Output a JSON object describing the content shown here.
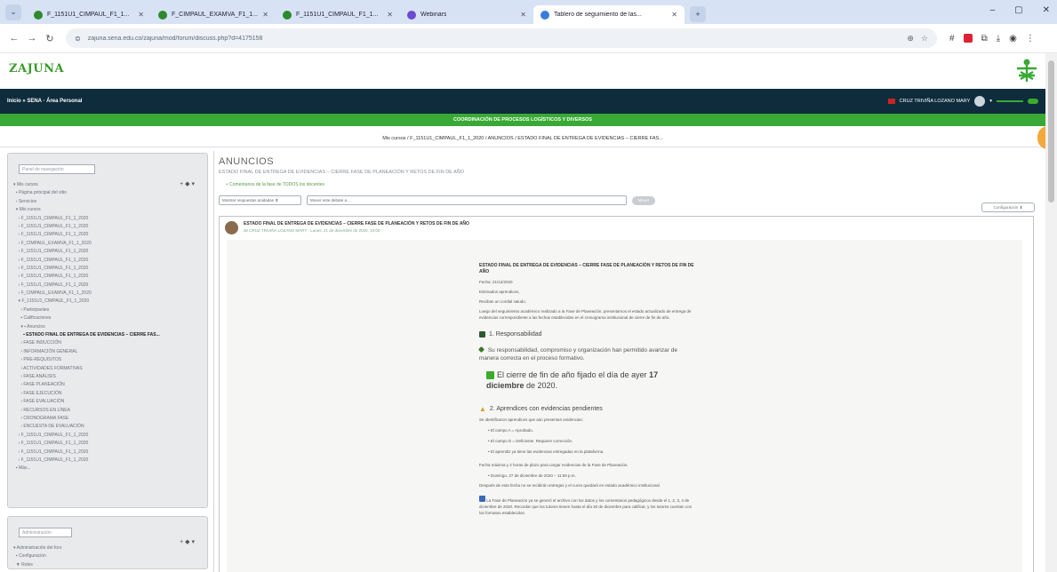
{
  "browser": {
    "tabs": [
      {
        "title": "F_1151U1_CIMPAUL_F1_1...",
        "color": "#2d8a2d",
        "active": false
      },
      {
        "title": "F_CIMPAUL_EXAMVA_F1_1...",
        "color": "#2d8a2d",
        "active": false
      },
      {
        "title": "F_1151U1_CIMPAUL_F1_1...",
        "color": "#2d8a2d",
        "active": false
      },
      {
        "title": "Webinars",
        "color": "#6b4bd1",
        "active": false
      },
      {
        "title": "Tablero de seguimiento de las...",
        "color": "#3a7be0",
        "active": true
      }
    ],
    "url": "zajuna.sena.edu.co/zajuna/mod/forum/discuss.php?d=4175158",
    "win_controls": [
      "–",
      "▢",
      "✕"
    ]
  },
  "site": {
    "logo": "ZAJUNA",
    "breadcrumb_left": "Inicio » SENA · Área Personal",
    "user_name": "CRUZ TRIVIÑA LOZANO MARY",
    "green_banner": "COORDINACIÓN DE PROCESOS LOGÍSTICOS Y DIVERSOS",
    "breadcrumb": "Mis cursos  /  F_1151U1_CIMPAUL_F1_1_2020  /  ANUNCIOS  /  ESTADO FINAL DE ENTREGA DE EVIDENCIAS – CIERRE FAS..."
  },
  "sidebar": {
    "block1_title": "Panel de navegación",
    "search_placeholder": "Buscar",
    "items": [
      {
        "label": "▾ Mis cursos",
        "sel": false
      },
      {
        "label": "  ▪ Página principal del sitio",
        "sel": false
      },
      {
        "label": "  › Servicios",
        "sel": false
      },
      {
        "label": "  ▾ Mis cursos",
        "sel": false
      },
      {
        "label": "    › F_1151U1_CIMPAUL_F1_1_2020",
        "sel": false
      },
      {
        "label": "    › F_1151U1_CIMPAUL_F1_1_2020",
        "sel": false
      },
      {
        "label": "    › F_1151U1_CIMPAUL_F1_1_2020",
        "sel": false
      },
      {
        "label": "    › F_CIMPAUL_EXAMVA_F1_1_2020",
        "sel": false
      },
      {
        "label": "    › F_1151U1_CIMPAUL_F1_1_2020",
        "sel": false
      },
      {
        "label": "    › F_1151U1_CIMPAUL_F1_1_2020",
        "sel": false
      },
      {
        "label": "    › F_1151U1_CIMPAUL_F1_1_2020",
        "sel": false
      },
      {
        "label": "    › F_1151U1_CIMPAUL_F1_1_2020",
        "sel": false
      },
      {
        "label": "    › F_1151U1_CIMPAUL_F1_1_2020",
        "sel": false
      },
      {
        "label": "    › F_CIMPAUL_EXAMVA_F1_1_2020",
        "sel": false
      },
      {
        "label": "    ▾ F_1151U1_CIMPAUL_F1_1_2020",
        "sel": false
      },
      {
        "label": "      › Participantes",
        "sel": false
      },
      {
        "label": "      ▪ Calificaciones",
        "sel": false
      },
      {
        "label": "      ▾ ▪ Anuncios",
        "sel": false
      },
      {
        "label": "        ▪ ESTADO FINAL DE ENTREGA DE EVIDENCIAS – CIERRE FAS...",
        "sel": true
      },
      {
        "label": "      › FASE INDUCCIÓN",
        "sel": false
      },
      {
        "label": "      › INFORMACIÓN GENERAL",
        "sel": false
      },
      {
        "label": "      › PRE-REQUISITOS",
        "sel": false
      },
      {
        "label": "      › ACTIVIDADES FORMATIVAS",
        "sel": false
      },
      {
        "label": "      › FASE ANÁLISIS",
        "sel": false
      },
      {
        "label": "      › FASE PLANEACIÓN",
        "sel": false
      },
      {
        "label": "      › FASE EJECUCIÓN",
        "sel": false
      },
      {
        "label": "      › FASE EVALUACIÓN",
        "sel": false
      },
      {
        "label": "      › RECURSOS EN LÍNEA",
        "sel": false
      },
      {
        "label": "      › CRONOGRAMA FASE",
        "sel": false
      },
      {
        "label": "      › ENCUESTA DE EVALUACIÓN",
        "sel": false
      },
      {
        "label": "    › F_1151U1_CIMPAUL_F1_1_2020",
        "sel": false
      },
      {
        "label": "    › F_1151U1_CIMPAUL_F1_1_2020",
        "sel": false
      },
      {
        "label": "    › F_1151U1_CIMPAUL_F1_1_2020",
        "sel": false
      },
      {
        "label": "    › F_1151U1_CIMPAUL_F1_1_2020",
        "sel": false
      },
      {
        "label": "  ▪ Más...",
        "sel": false
      }
    ],
    "block2_title": "Administración",
    "block2_items": [
      "▾ Administración del foro",
      "  ▪ Configuración",
      "  ▼ Roles"
    ],
    "tree_ctl": "+ ◆ ▾"
  },
  "main": {
    "title": "ANUNCIOS",
    "subtitle": "ESTADO FINAL DE ENTREGA DE EVIDENCIAS – CIERRE FASE DE PLANEACIÓN Y RETOS DE FIN DE AÑO",
    "subtle_link": "« Comentarios de la fase de TODOS los docentes",
    "filter1": "Mostrar respuestas anidadas  ⬍",
    "filter2": "Mover este debate a...",
    "move_btn": "Mover",
    "settings_btn": "Configuración ⬍",
    "post_title": "ESTADO FINAL DE ENTREGA DE EVIDENCIAS – CIERRE FASE DE PLANEACIÓN Y RETOS DE FIN DE AÑO",
    "post_meta": "de CRUZ TRIVIÑA LOZANO MARY · Lunes, 21 de diciembre de 2020, 10:00",
    "c_title": "ESTADO FINAL DE ENTREGA DE EVIDENCIAS – CIERRE FASE DE PLANEACIÓN Y RETOS DE FIN DE AÑO",
    "c_small1": "Fecha: 21/12/2020",
    "c_small2": "Estimados aprendices,",
    "c_small3": "Reciban un cordial saludo.",
    "c_small4": "Luego del seguimiento académico realizado a la Fase de Planeación, presentamos el estado actualizado de entrega de evidencias correspondiente a las fechas establecidas en el cronograma institucional de cierre de fin de año.",
    "h_resp": "1. Responsabilidad",
    "p_resp": "Su responsabilidad, compromiso y organización han permitido avanzar de manera correcta en el proceso formativo.",
    "big_a": "El cierre de fin de año fijado el día de ayer ",
    "big_b": "17 diciembre",
    "big_c": " de 2020.",
    "h_pend": "2. Aprendices con evidencias pendientes",
    "li_intro": "Se identificaron aprendices que aún presentan evidencias:",
    "li1": "•  El campo A = Aprobado.",
    "li2": "•  El campo D = Deficiente. Requiere corrección.",
    "li3": "•  El aprendiz ya tiene las evidencias entregadas en la plataforma.",
    "p_plazo": "Fecha máxima y 2 horas de plazo para cargar evidencias de la Fase de Planeación.",
    "li4": "•  Domingo, 27 de diciembre de 2020 – 11:59 p.m.",
    "li5": "Después de esta fecha no se recibirán entregas y el curso quedará en estado académico institucional.",
    "p_final": "La Fase de Planeación ya se generó el archivo con los datos y los comentarios pedagógicos desde el 1, 2, 3, 4 de diciembre de 2020. Recordar que los tutores tienen hasta el día 30 de diciembre para calificar, y los tutores cuentan con los formatos establecidos."
  },
  "colors": {
    "navbar": "#0e2c3c",
    "green": "#39a935",
    "orange": "#f2a93a"
  }
}
